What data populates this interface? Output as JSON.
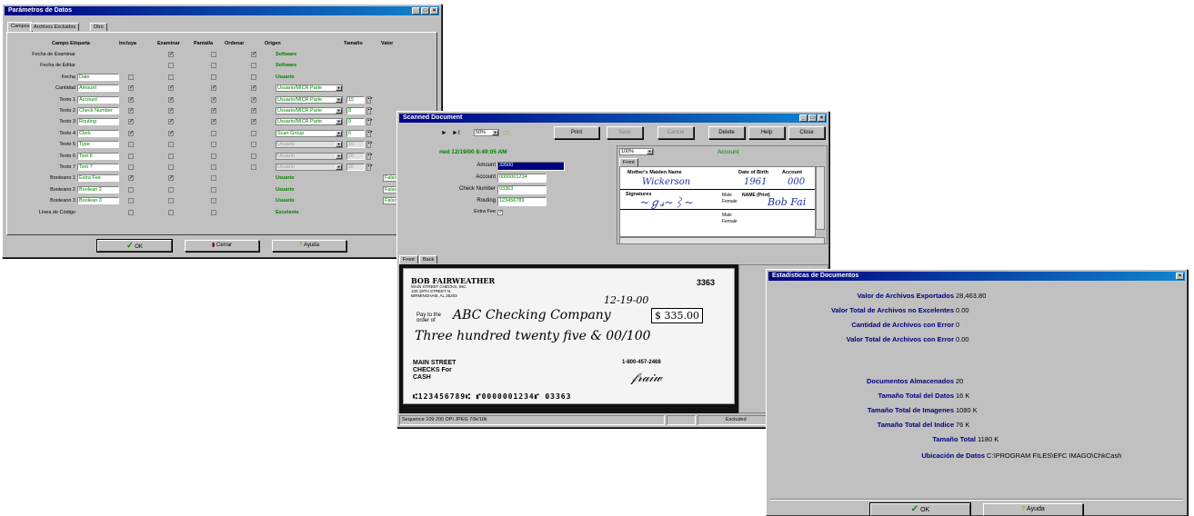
{
  "params": {
    "title": "Parámetros de Datos",
    "tabs": [
      "Campos",
      "Archivos Excluidos",
      "Otro"
    ],
    "headers": [
      "Campo Etiqueta",
      "Incluya",
      "Examinar",
      "Pantalla",
      "Ordenar",
      "Origen",
      "Tamaño",
      "Valor"
    ],
    "rows": [
      {
        "label": "Fecha de Examinar",
        "field": null,
        "inc": null,
        "exa": "✓",
        "pan": "",
        "ord": "✓",
        "origin": "Software",
        "size": null,
        "value": null
      },
      {
        "label": "Fecha de Editar",
        "field": null,
        "inc": null,
        "exa": "",
        "pan": "",
        "ord": "",
        "origin": "Software",
        "size": null,
        "value": null
      },
      {
        "label": "Fecha",
        "field": "Date",
        "inc": "",
        "exa": "",
        "pan": "",
        "ord": "",
        "origin": "Usuario",
        "size": null,
        "value": null
      },
      {
        "label": "Cantidad",
        "field": "Amount",
        "inc": "✓",
        "exa": "✓",
        "pan": "✓",
        "ord": "✓",
        "origin_sel": "Usuario/MICR Parte",
        "size": null,
        "value": null
      },
      {
        "label": "Texto 1",
        "field": "Account",
        "inc": "✓",
        "exa": "✓",
        "pan": "✓",
        "ord": "✓",
        "origin_sel": "Usuario/MICR Parte",
        "size": "15",
        "value": null
      },
      {
        "label": "Texto 2",
        "field": "Check Number",
        "inc": "✓",
        "exa": "✓",
        "pan": "✓",
        "ord": "✓",
        "origin_sel": "Usuario/MICR Parte",
        "size": "8",
        "value": null
      },
      {
        "label": "Texto 3",
        "field": "Routing",
        "inc": "✓",
        "exa": "✓",
        "pan": "✓",
        "ord": "✓",
        "origin_sel": "Usuario/MICR Parte",
        "size": "9",
        "value": null
      },
      {
        "label": "Texto 4",
        "field": "Clerk",
        "inc": "✓",
        "exa": "✓",
        "pan": "",
        "ord": "",
        "origin_sel": "Scan Group",
        "size": "6",
        "value": null
      },
      {
        "label": "Texto 5",
        "field": "Type",
        "inc": "",
        "exa": "",
        "pan": "",
        "ord": "",
        "origin_dis": "Usuario",
        "size_dis": "10",
        "value": null
      },
      {
        "label": "Texto 6",
        "field": "Text 6",
        "inc": "",
        "exa": "",
        "pan": "",
        "ord": "",
        "origin_dis": "Usuario",
        "size_dis": "20",
        "value": null
      },
      {
        "label": "Texto 7",
        "field": "Text 7",
        "inc": "",
        "exa": "",
        "pan": "",
        "ord": "",
        "origin_dis": "Usuario",
        "size_dis": "20",
        "value": null
      },
      {
        "label": "Booleano 1",
        "field": "Extra Fee",
        "inc": "✓",
        "exa": "✓",
        "pan": "",
        "ord": null,
        "origin": "Usuario",
        "size": null,
        "value": "Falso/No"
      },
      {
        "label": "Booleano 2",
        "field": "Boolean 2",
        "inc": "",
        "exa": "",
        "pan": "",
        "ord": null,
        "origin": "Usuario",
        "size": null,
        "value": "Falso/No"
      },
      {
        "label": "Booleano 3",
        "field": "Boolean 3",
        "inc": "",
        "exa": "",
        "pan": "",
        "ord": null,
        "origin": "Usuario",
        "size": null,
        "value": "Falso/No"
      },
      {
        "label": "Línea de Código",
        "field": null,
        "inc": "",
        "exa": "",
        "pan": "",
        "ord": null,
        "origin": "Excelente",
        "size": null,
        "value": null
      }
    ],
    "buttons": {
      "ok": "OK",
      "close": "Cerrar",
      "help": "Ayuda"
    }
  },
  "scanned": {
    "title": "Scanned Document",
    "zoom": "50%",
    "buttons": [
      "Print",
      "Save",
      "Cancel",
      "Delete",
      "Help",
      "Close"
    ],
    "timestamp": "ned 12/19/00 8:49:05 AM",
    "fields": [
      {
        "label": "Amount",
        "value": "33500"
      },
      {
        "label": "Account",
        "value": "0000001234"
      },
      {
        "label": "Check Number",
        "value": "03363"
      },
      {
        "label": "Routing",
        "value": "123456789"
      }
    ],
    "extra_fee_label": "Extra Fee",
    "extra_fee": "✓",
    "account_zoom": "100%",
    "account_title": "Account",
    "account_tab": "Front",
    "card": {
      "maiden_label": "Mother's Maiden Name",
      "maiden_value": "Wickerson",
      "dob_label": "Date of Birth",
      "dob_value": "1961",
      "acct_label": "Account",
      "acct_value": "000",
      "sig_label": "Signatures",
      "name_label": "NAME (Print)",
      "name_value": "Bob Fai",
      "male": "Male",
      "female": "Female"
    },
    "image_tabs": [
      "Front",
      "Back"
    ],
    "check": {
      "name": "BOB FAIRWEATHER",
      "address": "MAIN STREET CHECKS, INC.\n100 19TH STREET N.\nBIRMINGHAM, AL 35203",
      "number": "3363",
      "date": "12-19-00",
      "payee": "ABC Checking Company",
      "amount": "$ 335.00",
      "words": "Three hundred twenty five & 00/100",
      "phone": "1-800-457-2468",
      "bank": "MAIN STREET CHECKS For CASH",
      "micr": "⑆123456789⑆ ⑈0000001234⑈ 03363",
      "pay_to": "Pay to the order of"
    },
    "status": [
      "Sequence 109 200 DPI JPEG 70k/10k",
      "",
      "Excluded"
    ]
  },
  "stats": {
    "title": "Estadísticas de Documentos",
    "rows": [
      {
        "label": "Valor de Archivos Exportados",
        "value": "28,463.80"
      },
      {
        "label": "Valor Total de Archivos no Excelentes",
        "value": "0.00"
      },
      {
        "label": "Cantidad de Archivos con Error",
        "value": "0"
      },
      {
        "label": "Valor Total de Archivos con Error",
        "value": "0.00"
      },
      {
        "label": "Documentos Almacenados",
        "value": "20"
      },
      {
        "label": "Tamaño Total del Datos",
        "value": "16 K"
      },
      {
        "label": "Tamaño Total de Imagenes",
        "value": "1080 K"
      },
      {
        "label": "Tamaño Total del Indice",
        "value": "76 K"
      },
      {
        "label": "Tamaño Total",
        "value": "1180 K"
      },
      {
        "label": "Ubicación de Datos",
        "value": "C:\\PROGRAM FILES\\EFC IMAGO\\ChkCash"
      }
    ],
    "buttons": {
      "ok": "OK",
      "help": "Ayuda"
    }
  },
  "colors": {
    "title_start": "#000080",
    "title_end": "#1084d0",
    "window": "#c0c0c0",
    "accent_green": "#008000"
  }
}
